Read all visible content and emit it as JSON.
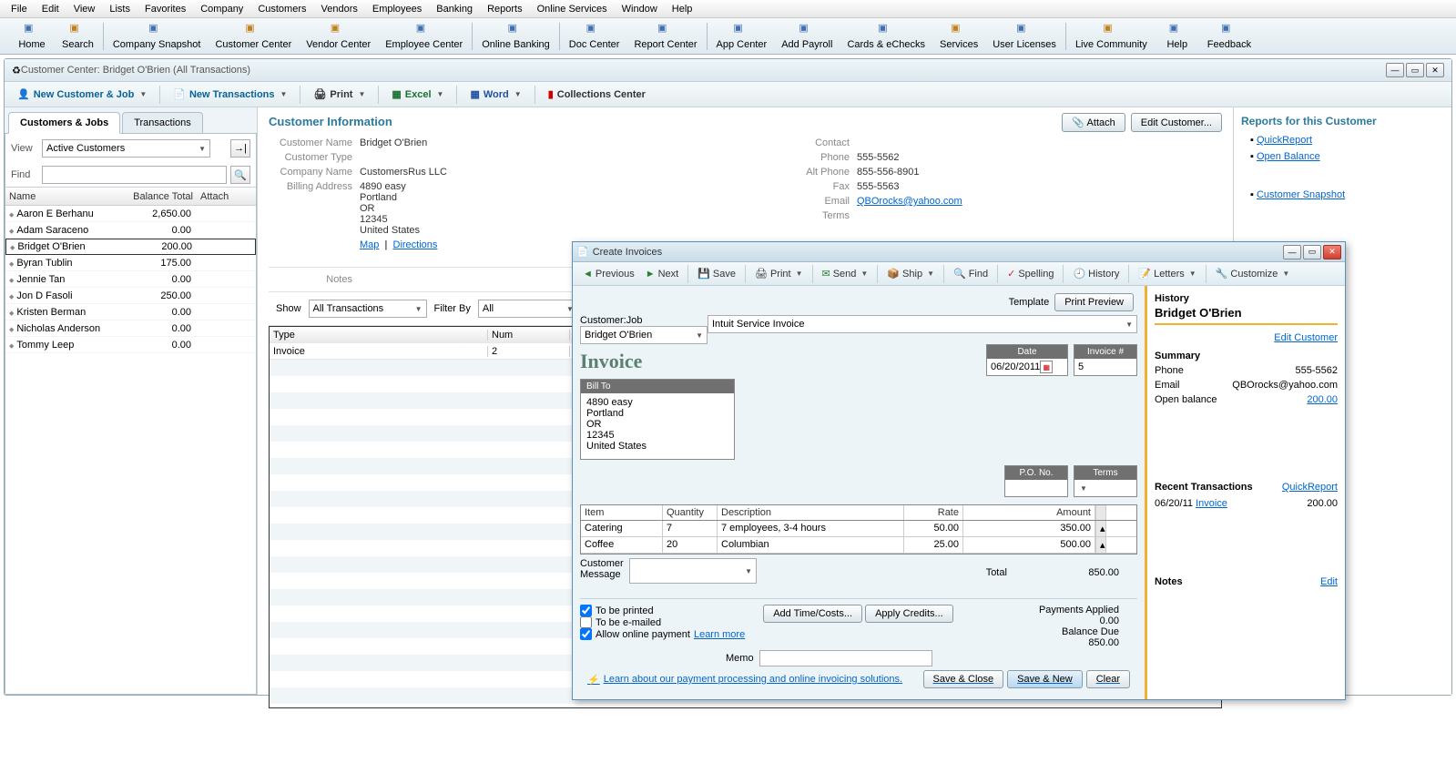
{
  "menubar": [
    "File",
    "Edit",
    "View",
    "Lists",
    "Favorites",
    "Company",
    "Customers",
    "Vendors",
    "Employees",
    "Banking",
    "Reports",
    "Online Services",
    "Window",
    "Help"
  ],
  "toolbar": [
    {
      "label": "Home",
      "sep": false
    },
    {
      "label": "Search",
      "sep": true
    },
    {
      "label": "Company Snapshot",
      "sep": false
    },
    {
      "label": "Customer Center",
      "sep": false
    },
    {
      "label": "Vendor Center",
      "sep": false
    },
    {
      "label": "Employee Center",
      "sep": true
    },
    {
      "label": "Online Banking",
      "sep": true
    },
    {
      "label": "Doc Center",
      "sep": false
    },
    {
      "label": "Report Center",
      "sep": true
    },
    {
      "label": "App Center",
      "sep": false
    },
    {
      "label": "Add Payroll",
      "sep": false
    },
    {
      "label": "Cards & eChecks",
      "sep": false
    },
    {
      "label": "Services",
      "sep": false
    },
    {
      "label": "User Licenses",
      "sep": true
    },
    {
      "label": "Live Community",
      "sep": false
    },
    {
      "label": "Help",
      "sep": false
    },
    {
      "label": "Feedback",
      "sep": false
    }
  ],
  "subwindow": {
    "title": "Customer Center: Bridget O'Brien (All Transactions)",
    "toolbar": {
      "new_customer": "New Customer & Job",
      "new_trans": "New Transactions",
      "print": "Print",
      "excel": "Excel",
      "word": "Word",
      "collections": "Collections Center"
    }
  },
  "tabs": {
    "customers": "Customers & Jobs",
    "transactions": "Transactions"
  },
  "view": {
    "label": "View",
    "value": "Active Customers",
    "find": "Find"
  },
  "cust_table": {
    "headers": {
      "name": "Name",
      "bal": "Balance Total",
      "attach": "Attach"
    },
    "rows": [
      {
        "name": "Aaron E Berhanu",
        "bal": "2,650.00"
      },
      {
        "name": "Adam Saraceno",
        "bal": "0.00"
      },
      {
        "name": "Bridget O'Brien",
        "bal": "200.00",
        "selected": true
      },
      {
        "name": "Byran Tublin",
        "bal": "175.00"
      },
      {
        "name": "Jennie Tan",
        "bal": "0.00"
      },
      {
        "name": "Jon D Fasoli",
        "bal": "250.00"
      },
      {
        "name": "Kristen Berman",
        "bal": "0.00"
      },
      {
        "name": "Nicholas Anderson",
        "bal": "0.00"
      },
      {
        "name": "Tommy Leep",
        "bal": "0.00"
      }
    ]
  },
  "cust_info": {
    "title": "Customer Information",
    "attach": "Attach",
    "edit": "Edit Customer...",
    "labels": {
      "name": "Customer Name",
      "type": "Customer Type",
      "company": "Company Name",
      "billing": "Billing Address",
      "contact": "Contact",
      "phone": "Phone",
      "alt": "Alt Phone",
      "fax": "Fax",
      "email": "Email",
      "terms": "Terms",
      "notes": "Notes"
    },
    "name": "Bridget O'Brien",
    "type": "",
    "company": "CustomersRus LLC",
    "addr": [
      "4890 easy",
      "Portland",
      "OR",
      "12345",
      "United States"
    ],
    "map": "Map",
    "directions": "Directions",
    "phone": "555-5562",
    "alt": "855-556-8901",
    "fax": "555-5563",
    "email": "QBOrocks@yahoo.com"
  },
  "reports": {
    "title": "Reports for this Customer",
    "links": [
      "QuickReport",
      "Open Balance",
      "Customer Snapshot"
    ]
  },
  "trans_filter": {
    "show": "Show",
    "show_val": "All Transactions",
    "filter": "Filter By",
    "filter_val": "All"
  },
  "trans_table": {
    "headers": {
      "type": "Type",
      "num": "Num"
    },
    "rows": [
      {
        "type": "Invoice",
        "num": "2"
      }
    ]
  },
  "invoice": {
    "title": "Create Invoices",
    "toolbar": {
      "prev": "Previous",
      "next": "Next",
      "save": "Save",
      "print": "Print",
      "send": "Send",
      "ship": "Ship",
      "find": "Find",
      "spell": "Spelling",
      "history": "History",
      "letters": "Letters",
      "custom": "Customize"
    },
    "cust_label": "Customer:Job",
    "cust_val": "Bridget O'Brien",
    "template_label": "Template",
    "template_val": "Intuit Service Invoice",
    "preview": "Print Preview",
    "heading": "Invoice",
    "date_label": "Date",
    "date_val": "06/20/2011",
    "invnum_label": "Invoice #",
    "invnum_val": "5",
    "billto_label": "Bill To",
    "billto": [
      "4890 easy",
      "Portland",
      "OR",
      "12345",
      "United States"
    ],
    "pono": "P.O. No.",
    "terms": "Terms",
    "cols": {
      "item": "Item",
      "qty": "Quantity",
      "desc": "Description",
      "rate": "Rate",
      "amt": "Amount"
    },
    "lines": [
      {
        "item": "Catering",
        "qty": "7",
        "desc": "7 employees, 3-4 hours",
        "rate": "50.00",
        "amt": "350.00"
      },
      {
        "item": "Coffee",
        "qty": "20",
        "desc": "Columbian",
        "rate": "25.00",
        "amt": "500.00"
      }
    ],
    "cust_msg": "Customer Message",
    "total_label": "Total",
    "total": "850.00",
    "printed": "To be printed",
    "emailed": "To be e-mailed",
    "online": "Allow online payment",
    "learn_more": "Learn more",
    "add_time": "Add Time/Costs...",
    "apply_credits": "Apply Credits...",
    "pay_applied_label": "Payments Applied",
    "pay_applied": "0.00",
    "bal_due_label": "Balance Due",
    "bal_due": "850.00",
    "memo": "Memo",
    "learn_link": "Learn about our payment processing and online invoicing solutions.",
    "save_close": "Save & Close",
    "save_new": "Save & New",
    "clear": "Clear",
    "side": {
      "history": "History",
      "name": "Bridget O'Brien",
      "edit": "Edit Customer",
      "summary": "Summary",
      "phone_l": "Phone",
      "phone": "555-5562",
      "email_l": "Email",
      "email": "QBOrocks@yahoo.com",
      "open_l": "Open balance",
      "open": "200.00",
      "recent": "Recent Transactions",
      "quick": "QuickReport",
      "trans": [
        {
          "date": "06/20/11",
          "type": "Invoice",
          "amt": "200.00"
        }
      ],
      "notes": "Notes",
      "edit2": "Edit"
    }
  }
}
